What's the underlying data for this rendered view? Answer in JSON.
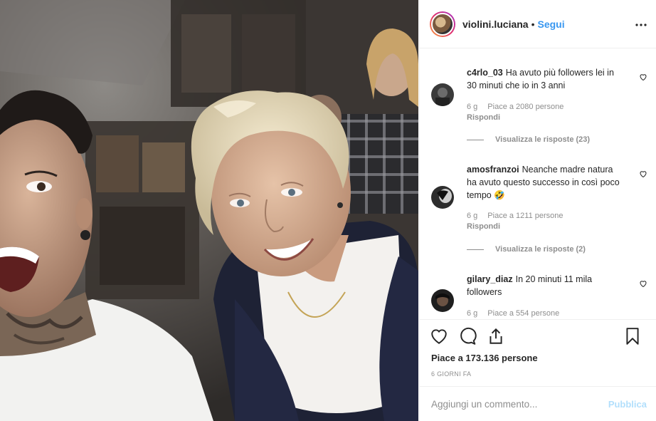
{
  "post": {
    "username": "violini.luciana",
    "separator": "•",
    "follow_label": "Segui",
    "more_icon": "more-options-icon"
  },
  "comments": [
    {
      "username": "c4rlo_03",
      "text": "Ha avuto più followers lei in 30 minuti che io in 3 anni",
      "age": "6 g",
      "likes": "Piace a 2080 persone",
      "reply": "Rispondi",
      "view_replies": "Visualizza le risposte (23)"
    },
    {
      "username": "amosfranzoi",
      "text": "Neanche madre natura ha avuto questo successo in così poco tempo 🤣",
      "age": "6 g",
      "likes": "Piace a 1211 persone",
      "reply": "Rispondi",
      "view_replies": "Visualizza le risposte (2)"
    },
    {
      "username": "gilary_diaz",
      "text": "In 20 minuti 11 mila followers",
      "age": "6 g",
      "likes": "Piace a 554 persone"
    }
  ],
  "actions": {
    "like_icon": "heart-icon",
    "comment_icon": "comment-icon",
    "share_icon": "share-icon",
    "save_icon": "bookmark-icon",
    "likes_total": "Piace a 173.136 persone",
    "date": "6 GIORNI FA"
  },
  "add_comment": {
    "placeholder": "Aggiungi un commento...",
    "post_label": "Pubblica"
  },
  "colors": {
    "link": "#3897f0",
    "muted": "#8e8e8e",
    "post_disabled": "#b2dffc",
    "text": "#262626"
  }
}
